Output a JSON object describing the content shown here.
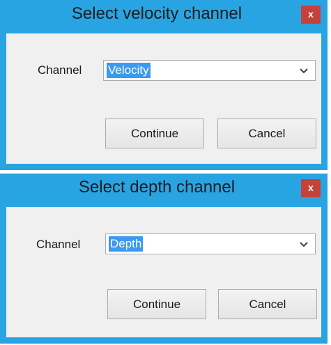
{
  "dialogs": [
    {
      "title": "Select velocity channel",
      "close_label": "x",
      "channel_label": "Channel",
      "channel_value": "Velocity",
      "continue_label": "Continue",
      "cancel_label": "Cancel"
    },
    {
      "title": "Select depth channel",
      "close_label": "x",
      "channel_label": "Channel",
      "channel_value": "Depth",
      "continue_label": "Continue",
      "cancel_label": "Cancel"
    }
  ],
  "colors": {
    "frame": "#29a4e3",
    "close_button": "#c7413b",
    "selection": "#3a9af0",
    "client": "#f0f0f0"
  },
  "icons": {
    "dropdown": "chevron-down-icon"
  }
}
